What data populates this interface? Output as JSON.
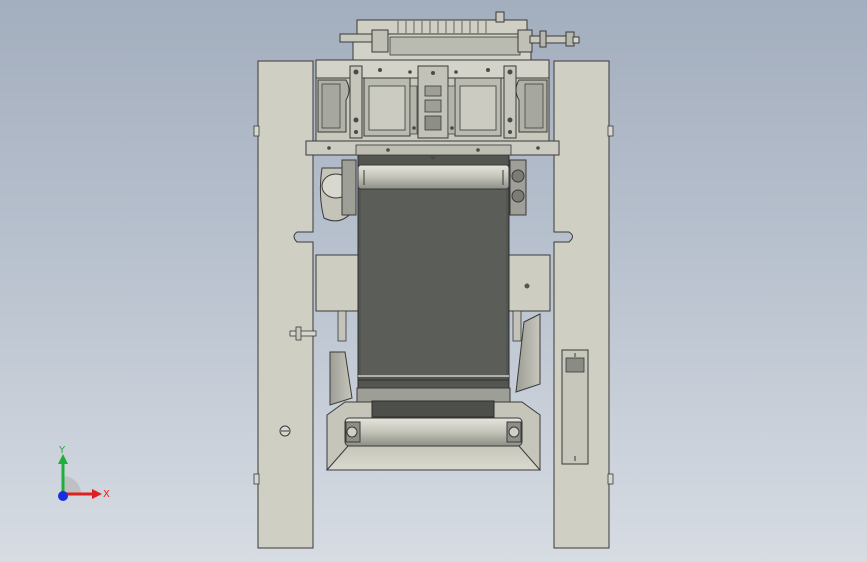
{
  "viewport": {
    "background_top": "#a3aebe",
    "background_bottom": "#d7dce3"
  },
  "model": {
    "part_fill": "#cfcfc4",
    "part_dark": "#4d4f4b",
    "edge": "#3a3a3a",
    "belt": "#535550"
  },
  "triad": {
    "y_label": "Y",
    "x_label": "X",
    "y_color": "#1fae3a",
    "x_color": "#e02020",
    "z_color": "#1a2ee0"
  }
}
